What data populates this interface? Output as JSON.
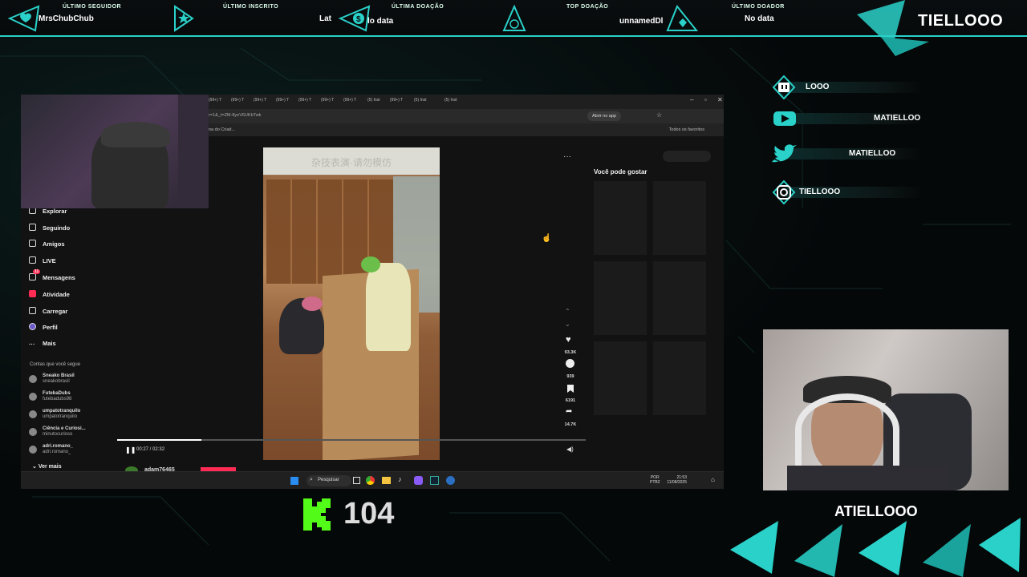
{
  "topbar": {
    "follower": {
      "label": "Último seguidor",
      "value": "MrsChubChub",
      "icon": "heart-icon"
    },
    "subscriber": {
      "label": "Último inscrito",
      "value": "Lat",
      "icon": "star-icon"
    },
    "donation": {
      "label": "Última doação",
      "value": "lo data",
      "icon": "dollar-icon"
    },
    "top_donation": {
      "label": "Top doação",
      "value": "unnamedDl",
      "icon": "money-bag-icon"
    },
    "last_donor": {
      "label": "Último doador",
      "value": "No data",
      "icon": "diamond-icon"
    },
    "brand": "TIELLOOO"
  },
  "socials": [
    {
      "platform": "twitch-icon",
      "handle": "LOOO"
    },
    {
      "platform": "youtube-icon",
      "handle": "MATIELLOO"
    },
    {
      "platform": "twitter-icon",
      "handle": "MATIELLOO"
    },
    {
      "platform": "instagram-icon",
      "handle": "TIELLOOO"
    }
  ],
  "browser": {
    "url": "r=1&_t=ZM-8yeV6UKbTwk",
    "open_app": "Abrir no app",
    "bookmark_left": "na do Criad...",
    "bookmark_right": "Todos os favoritos",
    "tabs": [
      "(99+) T",
      "(99+) T",
      "(99+) T",
      "(99+) T",
      "(99+) T",
      "(99+) T",
      "(99+) T",
      "(5) Inst",
      "(99+) T",
      "(5) Inst",
      "(5) Inst"
    ]
  },
  "sidebar": {
    "items": [
      "Explorar",
      "Seguindo",
      "Amigos",
      "LIVE",
      "Mensagens",
      "Atividade",
      "Carregar",
      "Perfil",
      "Mais"
    ],
    "following_title": "Contas que você segue",
    "following": [
      {
        "name": "Sneako Brasil",
        "handle": "sneakobrasil"
      },
      {
        "name": "FutebaDubs",
        "handle": "futebadubs98"
      },
      {
        "name": "umpatotranquilo",
        "handle": "umpatotranquilo"
      },
      {
        "name": "Ciência e Curiosi...",
        "handle": "minutocurioso"
      },
      {
        "name": "adri.romano_",
        "handle": "adri.romano_"
      }
    ],
    "see_more": "Ver mais",
    "badge": "11"
  },
  "video": {
    "caption_overlay": "杂技表演·请勿模仿",
    "time": "00:27 / 02:32",
    "progress": 0.18,
    "author": "adam76465",
    "likes": "93.3K",
    "comments": "939",
    "saves": "6191",
    "shares": "14.7K"
  },
  "recommend": {
    "title": "Você pode gostar"
  },
  "taskbar": {
    "search": "Pesquisar",
    "lang": "POR",
    "kbd": "PTB2",
    "time": "21:53",
    "date": "11/08/2025"
  },
  "kick": {
    "count": "104"
  },
  "brand_bottom": "ATIELLOOO",
  "colors": {
    "accent": "#2ad1c9",
    "kick": "#53fc18"
  }
}
